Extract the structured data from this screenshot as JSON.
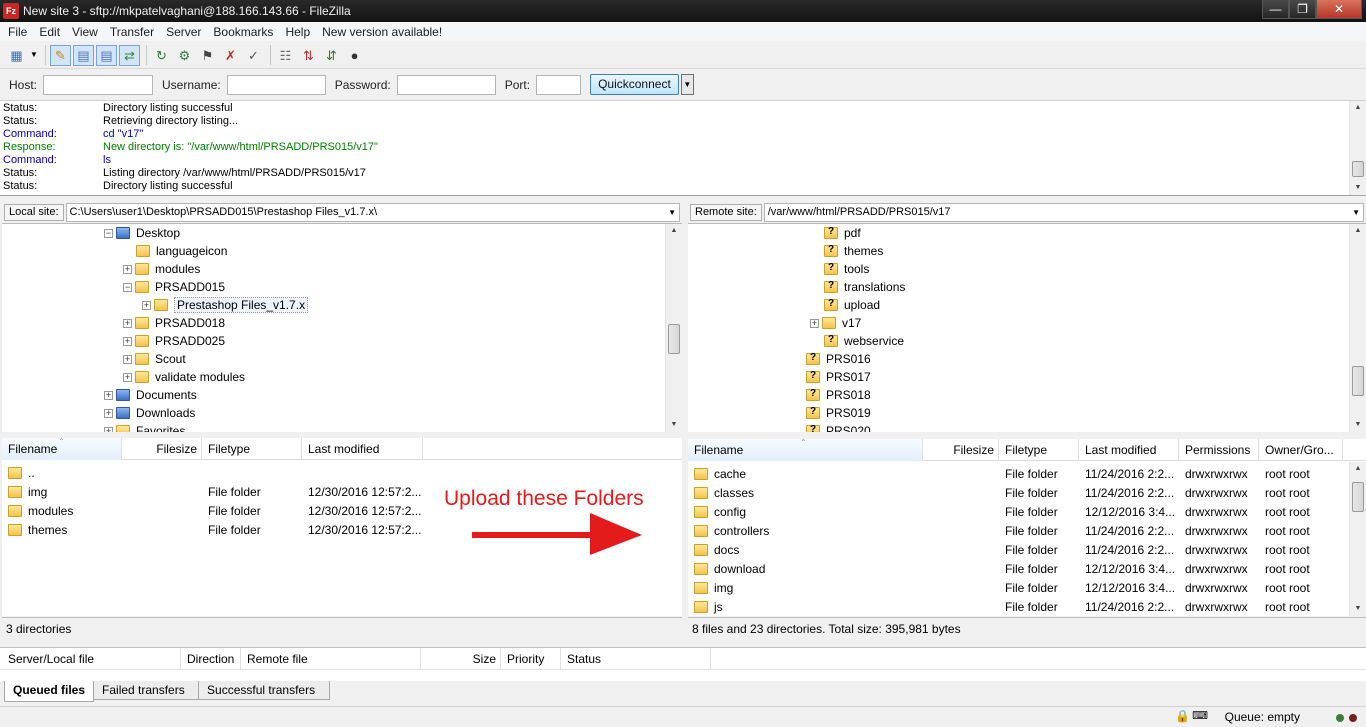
{
  "window": {
    "title": "New site 3 - sftp://mkpatelvaghani@188.166.143.66 - FileZilla",
    "app_icon": "Fz"
  },
  "menu": [
    "File",
    "Edit",
    "View",
    "Transfer",
    "Server",
    "Bookmarks",
    "Help",
    "New version available!"
  ],
  "quickconnect": {
    "host_label": "Host:",
    "username_label": "Username:",
    "password_label": "Password:",
    "port_label": "Port:",
    "button_label": "Quickconnect"
  },
  "log": [
    {
      "type": "Status:",
      "msg": "Directory listing successful",
      "kind": "status"
    },
    {
      "type": "Status:",
      "msg": "Retrieving directory listing...",
      "kind": "status"
    },
    {
      "type": "Command:",
      "msg": "cd \"v17\"",
      "kind": "cmd"
    },
    {
      "type": "Response:",
      "msg": "New directory is: \"/var/www/html/PRSADD/PRS015/v17\"",
      "kind": "resp"
    },
    {
      "type": "Command:",
      "msg": "ls",
      "kind": "cmd"
    },
    {
      "type": "Status:",
      "msg": "Listing directory /var/www/html/PRSADD/PRS015/v17",
      "kind": "status"
    },
    {
      "type": "Status:",
      "msg": "Directory listing successful",
      "kind": "status"
    }
  ],
  "local": {
    "label": "Local site:",
    "path": "C:\\Users\\user1\\Desktop\\PRSADD015\\Prestashop Files_v1.7.x\\",
    "tree": [
      "Desktop",
      "languageicon",
      "modules",
      "PRSADD015",
      "Prestashop Files_v1.7.x",
      "PRSADD018",
      "PRSADD025",
      "Scout",
      "validate modules",
      "Documents",
      "Downloads",
      "Favorites"
    ],
    "columns": [
      "Filename",
      "Filesize",
      "Filetype",
      "Last modified"
    ],
    "files": [
      {
        "name": "..",
        "size": "",
        "type": "",
        "modified": ""
      },
      {
        "name": "img",
        "size": "",
        "type": "File folder",
        "modified": "12/30/2016 12:57:2..."
      },
      {
        "name": "modules",
        "size": "",
        "type": "File folder",
        "modified": "12/30/2016 12:57:2..."
      },
      {
        "name": "themes",
        "size": "",
        "type": "File folder",
        "modified": "12/30/2016 12:57:2..."
      }
    ],
    "status": "3 directories"
  },
  "remote": {
    "label": "Remote site:",
    "path": "/var/www/html/PRSADD/PRS015/v17",
    "tree": [
      "pdf",
      "themes",
      "tools",
      "translations",
      "upload",
      "v17",
      "webservice",
      "PRS016",
      "PRS017",
      "PRS018",
      "PRS019",
      "PRS020"
    ],
    "columns": [
      "Filename",
      "Filesize",
      "Filetype",
      "Last modified",
      "Permissions",
      "Owner/Gro..."
    ],
    "files": [
      {
        "name": "cache",
        "size": "",
        "type": "File folder",
        "modified": "11/24/2016 2:2...",
        "perms": "drwxrwxrwx",
        "owner": "root root"
      },
      {
        "name": "classes",
        "size": "",
        "type": "File folder",
        "modified": "11/24/2016 2:2...",
        "perms": "drwxrwxrwx",
        "owner": "root root"
      },
      {
        "name": "config",
        "size": "",
        "type": "File folder",
        "modified": "12/12/2016 3:4...",
        "perms": "drwxrwxrwx",
        "owner": "root root"
      },
      {
        "name": "controllers",
        "size": "",
        "type": "File folder",
        "modified": "11/24/2016 2:2...",
        "perms": "drwxrwxrwx",
        "owner": "root root"
      },
      {
        "name": "docs",
        "size": "",
        "type": "File folder",
        "modified": "11/24/2016 2:2...",
        "perms": "drwxrwxrwx",
        "owner": "root root"
      },
      {
        "name": "download",
        "size": "",
        "type": "File folder",
        "modified": "12/12/2016 3:4...",
        "perms": "drwxrwxrwx",
        "owner": "root root"
      },
      {
        "name": "img",
        "size": "",
        "type": "File folder",
        "modified": "12/12/2016 3:4...",
        "perms": "drwxrwxrwx",
        "owner": "root root"
      },
      {
        "name": "js",
        "size": "",
        "type": "File folder",
        "modified": "11/24/2016 2:2...",
        "perms": "drwxrwxrwx",
        "owner": "root root"
      }
    ],
    "status": "8 files and 23 directories. Total size: 395,981 bytes"
  },
  "annotation": "Upload these Folders",
  "queue": {
    "columns": [
      "Server/Local file",
      "Direction",
      "Remote file",
      "Size",
      "Priority",
      "Status"
    ],
    "tabs": [
      "Queued files",
      "Failed transfers",
      "Successful transfers"
    ],
    "status": "Queue: empty"
  },
  "colors": {
    "annotation": "#e31b1b",
    "command": "#0000c0",
    "response": "#008000"
  }
}
